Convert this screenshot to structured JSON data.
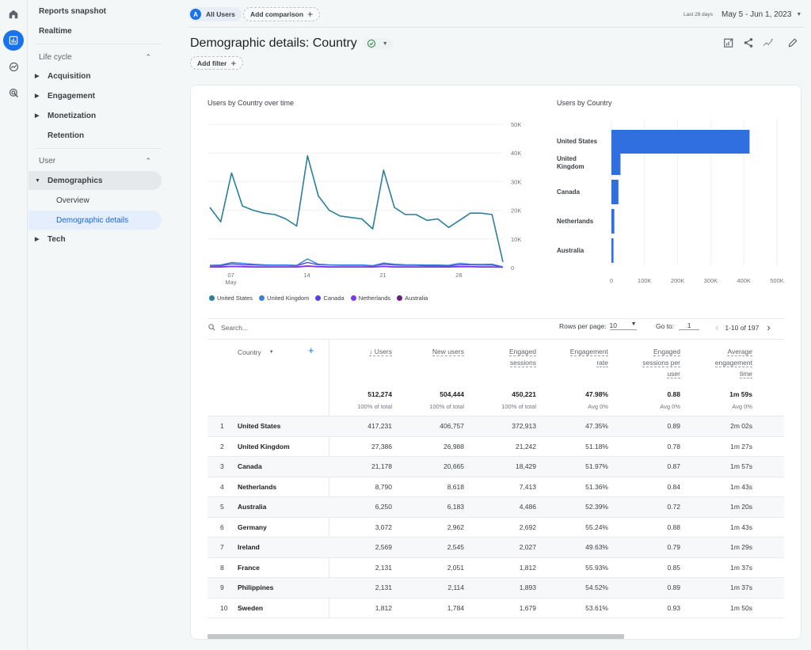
{
  "rail": {
    "icons": [
      "home-icon",
      "reports-icon",
      "explore-icon",
      "advertising-icon"
    ],
    "active_index": 1
  },
  "sidebar": {
    "reports_snapshot": "Reports snapshot",
    "realtime": "Realtime",
    "lifecycle_section": "Life cycle",
    "lifecycle_items": [
      "Acquisition",
      "Engagement",
      "Monetization",
      "Retention"
    ],
    "user_section": "User",
    "demographics": "Demographics",
    "overview": "Overview",
    "demographic_details": "Demographic details",
    "tech": "Tech"
  },
  "header": {
    "segment_avatar": "A",
    "segment_label": "All Users",
    "add_comparison": "Add comparison",
    "date_hint": "Last 28 days",
    "date_range": "May 5 - Jun 1, 2023",
    "page_title": "Demographic details: Country",
    "add_filter": "Add filter",
    "tools": [
      "customize-report-icon",
      "share-icon",
      "insights-icon",
      "edit-icon"
    ]
  },
  "colors": {
    "accent": "#1a73e8",
    "bar": "#2f6fe0",
    "series": [
      "#2a7f9e",
      "#3b82d6",
      "#4f46e5",
      "#7c3aed",
      "#6b1d84"
    ]
  },
  "chart_data": [
    {
      "type": "line",
      "title": "Users by Country over time",
      "x": [
        "May 5",
        "May 6",
        "May 7",
        "May 8",
        "May 9",
        "May 10",
        "May 11",
        "May 12",
        "May 13",
        "May 14",
        "May 15",
        "May 16",
        "May 17",
        "May 18",
        "May 19",
        "May 20",
        "May 21",
        "May 22",
        "May 23",
        "May 24",
        "May 25",
        "May 26",
        "May 27",
        "May 28",
        "May 29",
        "May 30",
        "May 31",
        "Jun 1"
      ],
      "x_tick_labels": [
        {
          "label": "07",
          "sub": "May",
          "index": 2
        },
        {
          "label": "14",
          "index": 9
        },
        {
          "label": "21",
          "index": 16
        },
        {
          "label": "28",
          "index": 23
        }
      ],
      "y_tick_labels": [
        "0",
        "10K",
        "20K",
        "30K",
        "40K",
        "50K"
      ],
      "ylim": [
        0,
        50000
      ],
      "grid": true,
      "legend_position": "bottom-left",
      "series": [
        {
          "name": "United States",
          "values": [
            21000,
            16000,
            33000,
            21500,
            20000,
            19000,
            18500,
            17000,
            14500,
            39000,
            25000,
            20000,
            18000,
            17500,
            17000,
            13500,
            34000,
            21000,
            18500,
            18500,
            16500,
            17000,
            14000,
            16500,
            19000,
            19000,
            18500,
            2000
          ]
        },
        {
          "name": "United Kingdom",
          "values": [
            800,
            900,
            1800,
            1500,
            1200,
            1000,
            900,
            900,
            800,
            3000,
            1200,
            1000,
            900,
            900,
            900,
            700,
            1600,
            1200,
            1000,
            1000,
            900,
            900,
            800,
            1500,
            1200,
            1100,
            1200,
            300
          ]
        },
        {
          "name": "Canada",
          "values": [
            700,
            700,
            1300,
            1000,
            900,
            800,
            800,
            800,
            700,
            1800,
            1000,
            900,
            800,
            800,
            800,
            600,
            1200,
            900,
            800,
            800,
            700,
            700,
            600,
            1000,
            1000,
            900,
            900,
            200
          ]
        },
        {
          "name": "Netherlands",
          "values": [
            300,
            300,
            500,
            400,
            300,
            300,
            300,
            300,
            300,
            600,
            400,
            300,
            300,
            300,
            300,
            300,
            500,
            300,
            300,
            300,
            300,
            300,
            300,
            400,
            400,
            300,
            300,
            100
          ]
        },
        {
          "name": "Australia",
          "values": [
            200,
            200,
            400,
            300,
            200,
            200,
            200,
            200,
            200,
            500,
            300,
            200,
            200,
            200,
            200,
            200,
            400,
            200,
            200,
            200,
            200,
            200,
            200,
            300,
            300,
            200,
            200,
            100
          ]
        }
      ]
    },
    {
      "type": "bar",
      "orientation": "horizontal",
      "title": "Users by Country",
      "categories": [
        "United States",
        "United Kingdom",
        "Canada",
        "Netherlands",
        "Australia"
      ],
      "values": [
        417231,
        27386,
        21178,
        8790,
        6250
      ],
      "x_tick_labels": [
        "0",
        "100K",
        "200K",
        "300K",
        "400K",
        "500K"
      ],
      "xlim": [
        0,
        500000
      ],
      "grid": true
    }
  ],
  "table": {
    "search_placeholder": "Search...",
    "rows_per_page_label": "Rows per page:",
    "rows_per_page": "10",
    "goto_label": "Go to:",
    "goto_value": "1",
    "page_range": "1-10 of 197",
    "dimension_header": "Country",
    "columns": [
      {
        "label_lines": [
          "↓ Users"
        ],
        "total": "512,274",
        "sub": "100% of total"
      },
      {
        "label_lines": [
          "New users"
        ],
        "total": "504,444",
        "sub": "100% of total"
      },
      {
        "label_lines": [
          "Engaged",
          "sessions"
        ],
        "total": "450,221",
        "sub": "100% of total"
      },
      {
        "label_lines": [
          "Engagement",
          "rate"
        ],
        "total": "47.98%",
        "sub": "Avg 0%"
      },
      {
        "label_lines": [
          "Engaged",
          "sessions per",
          "user"
        ],
        "total": "0.88",
        "sub": "Avg 0%"
      },
      {
        "label_lines": [
          "Average",
          "engagement",
          "time"
        ],
        "total": "1m 59s",
        "sub": "Avg 0%"
      }
    ],
    "rows": [
      {
        "rank": "1",
        "country": "United States",
        "values": [
          "417,231",
          "406,757",
          "372,913",
          "47.35%",
          "0.89",
          "2m 02s"
        ]
      },
      {
        "rank": "2",
        "country": "United Kingdom",
        "values": [
          "27,386",
          "26,988",
          "21,242",
          "51.18%",
          "0.78",
          "1m 27s"
        ]
      },
      {
        "rank": "3",
        "country": "Canada",
        "values": [
          "21,178",
          "20,665",
          "18,429",
          "51.97%",
          "0.87",
          "1m 57s"
        ]
      },
      {
        "rank": "4",
        "country": "Netherlands",
        "values": [
          "8,790",
          "8,618",
          "7,413",
          "51.36%",
          "0.84",
          "1m 43s"
        ]
      },
      {
        "rank": "5",
        "country": "Australia",
        "values": [
          "6,250",
          "6,183",
          "4,486",
          "52.39%",
          "0.72",
          "1m 20s"
        ]
      },
      {
        "rank": "6",
        "country": "Germany",
        "values": [
          "3,072",
          "2,962",
          "2,692",
          "55.24%",
          "0.88",
          "1m 43s"
        ]
      },
      {
        "rank": "7",
        "country": "Ireland",
        "values": [
          "2,569",
          "2,545",
          "2,027",
          "49.63%",
          "0.79",
          "1m 29s"
        ]
      },
      {
        "rank": "8",
        "country": "France",
        "values": [
          "2,131",
          "2,051",
          "1,812",
          "55.93%",
          "0.85",
          "1m 37s"
        ]
      },
      {
        "rank": "9",
        "country": "Philippines",
        "values": [
          "2,131",
          "2,114",
          "1,893",
          "54.52%",
          "0.89",
          "1m 37s"
        ]
      },
      {
        "rank": "10",
        "country": "Sweden",
        "values": [
          "1,812",
          "1,784",
          "1,679",
          "53.61%",
          "0.93",
          "1m 50s"
        ]
      }
    ]
  }
}
